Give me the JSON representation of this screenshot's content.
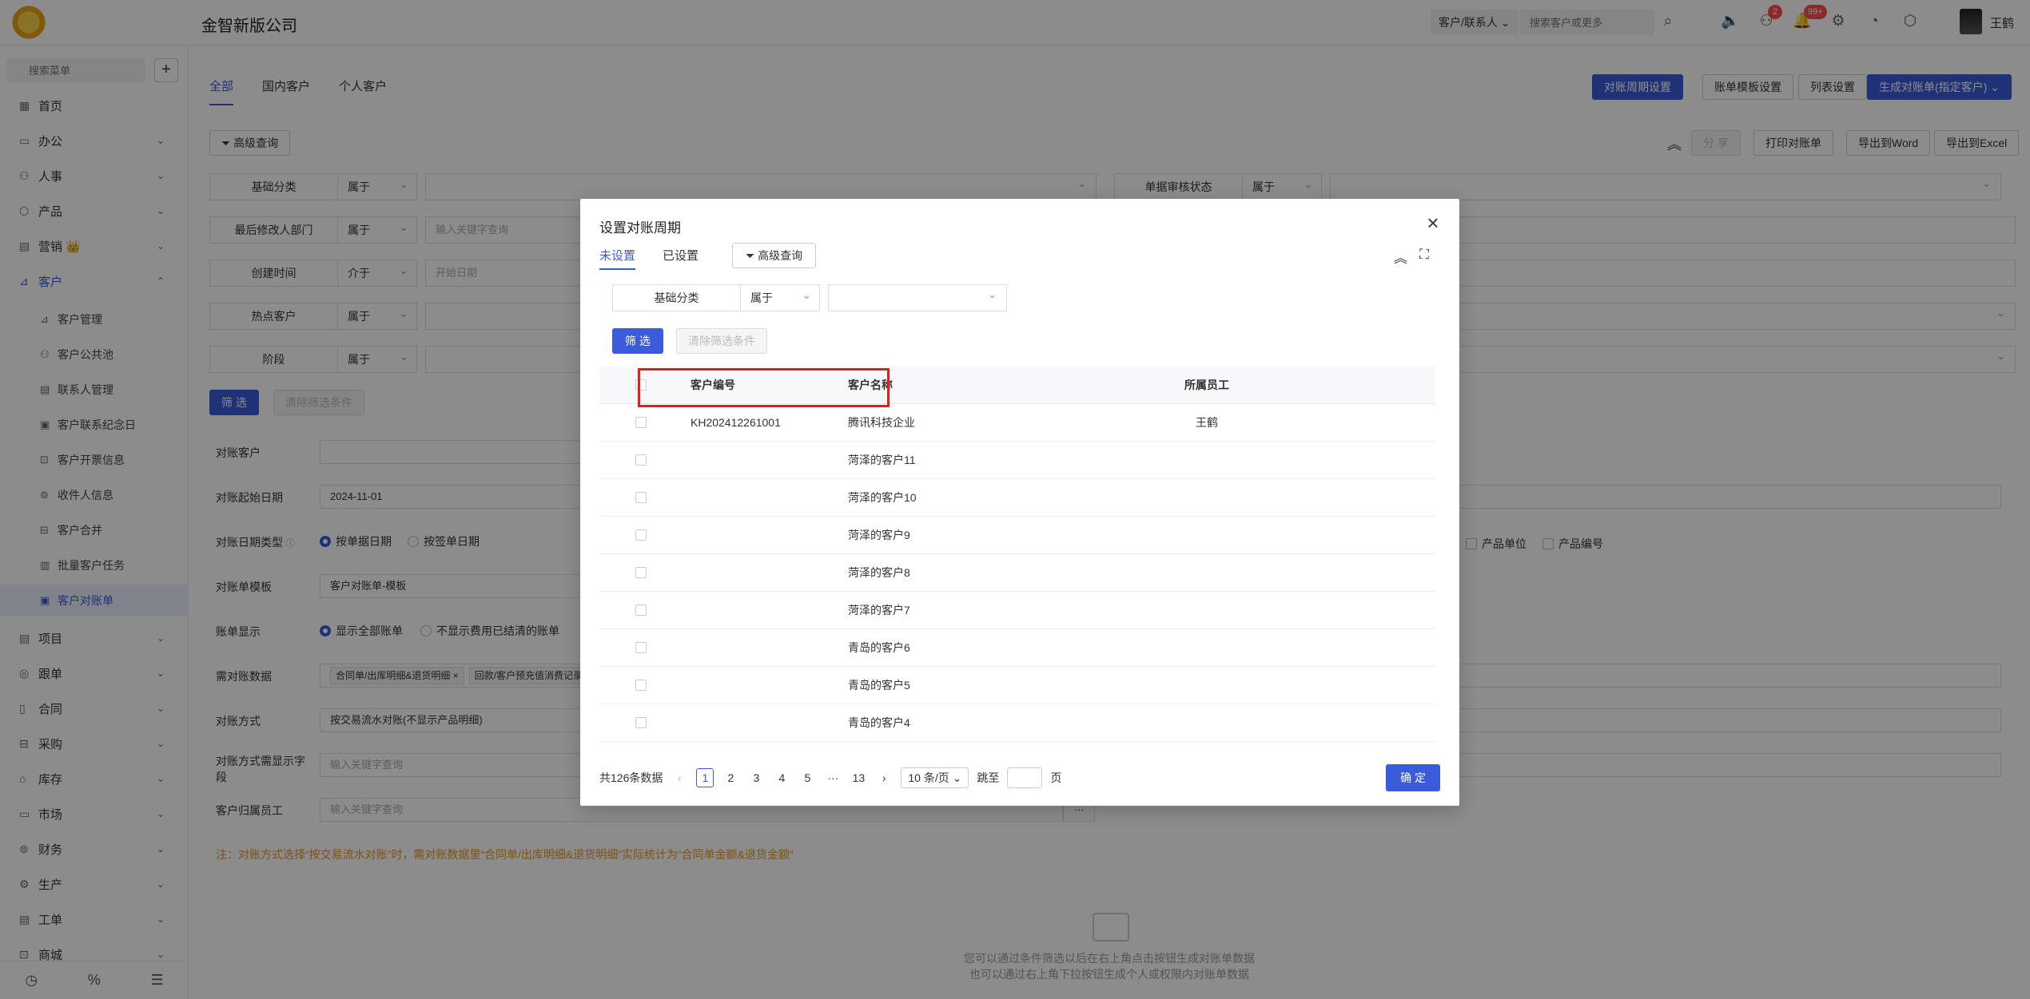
{
  "header": {
    "app_title": "金智新版公司",
    "search_type": "客户/联系人",
    "search_placeholder": "搜索客户或更多",
    "badges": {
      "notice": "2",
      "bell": "99+"
    },
    "user_name": "王鹤"
  },
  "sidebar": {
    "search_placeholder": "搜索菜单",
    "items": [
      {
        "label": "首页",
        "icon": "▦"
      },
      {
        "label": "办公",
        "icon": "▭"
      },
      {
        "label": "人事",
        "icon": "⚇"
      },
      {
        "label": "产品",
        "icon": "⬡"
      },
      {
        "label": "营销 👑",
        "icon": "▤"
      },
      {
        "label": "客户",
        "icon": "⊿"
      }
    ],
    "sub_items": [
      {
        "label": "客户管理",
        "icon": "⊿"
      },
      {
        "label": "客户公共池",
        "icon": "⚇"
      },
      {
        "label": "联系人管理",
        "icon": "▤"
      },
      {
        "label": "客户联系纪念日",
        "icon": "▣"
      },
      {
        "label": "客户开票信息",
        "icon": "⊡"
      },
      {
        "label": "收件人信息",
        "icon": "⊚"
      },
      {
        "label": "客户合并",
        "icon": "⊟"
      },
      {
        "label": "批量客户任务",
        "icon": "▥"
      },
      {
        "label": "客户对账单",
        "icon": "▣"
      }
    ],
    "bottom_items": [
      {
        "label": "项目",
        "icon": "▤"
      },
      {
        "label": "跟单",
        "icon": "◎"
      },
      {
        "label": "合同",
        "icon": "▯"
      },
      {
        "label": "采购",
        "icon": "⊟"
      },
      {
        "label": "库存",
        "icon": "⌂"
      },
      {
        "label": "市场",
        "icon": "▭"
      },
      {
        "label": "财务",
        "icon": "⊚"
      },
      {
        "label": "生产",
        "icon": "⚙"
      },
      {
        "label": "工单",
        "icon": "▤"
      },
      {
        "label": "商城",
        "icon": "⊡"
      }
    ]
  },
  "main": {
    "tabs": [
      "全部",
      "国内客户",
      "个人客户"
    ],
    "actions": {
      "cycle": "对账周期设置",
      "template": "账单模板设置",
      "columns": "列表设置",
      "generate": "生成对账单(指定客户)"
    },
    "advanced_query": "高级查询",
    "toolbar": {
      "share": "分 享",
      "print": "打印对账单",
      "word": "导出到Word",
      "excel": "导出到Excel"
    },
    "filters": [
      {
        "label": "基础分类",
        "op": "属于",
        "value": ""
      },
      {
        "label": "最后修改人部门",
        "op": "属于",
        "value": "输入关键字查询"
      },
      {
        "label": "创建时间",
        "op": "介于",
        "value": "开始日期"
      },
      {
        "label": "热点客户",
        "op": "属于",
        "value": ""
      },
      {
        "label": "阶段",
        "op": "属于",
        "value": ""
      }
    ],
    "right_filter": {
      "label": "单据审核状态",
      "op": "属于"
    },
    "filter_btn": "筛 选",
    "clear_btn": "清除筛选条件",
    "form": {
      "customer_label": "对账客户",
      "start_date_label": "对账起始日期",
      "start_date": "2024-11-01",
      "date_type_label": "对账日期类型",
      "date_type_opt1": "按单据日期",
      "date_type_opt2": "按签单日期",
      "template_label": "对账单模板",
      "template_value": "客户对账单-模板",
      "display_label": "账单显示",
      "display_opt1": "显示全部账单",
      "display_opt2": "不显示费用已结清的账单",
      "data_label": "需对账数据",
      "data_tag1": "合同单/出库明细&退货明细 ×",
      "data_tag2": "回款/客户预充值消费记录",
      "method_label": "对账方式",
      "method_value": "按交易流水对账(不显示产品明细)",
      "field_label": "对账方式需显示字段",
      "field_placeholder": "输入关键字查询",
      "owner_label": "客户归属员工",
      "owner_placeholder": "输入关键字查询",
      "chk_unit": "产品单位",
      "chk_code": "产品编号"
    },
    "note": "注：对账方式选择“按交易流水对账”时，需对账数据里“合同单/出库明细&退货明细”实际统计为“合同单金额&退货金额”",
    "empty_text_1": "您可以通过条件筛选以后在右上角点击按钮生成对账单数据",
    "empty_text_2": "也可以通过右上角下拉按钮生成个人或权限内对账单数据"
  },
  "modal": {
    "title": "设置对账周期",
    "tabs": [
      "未设置",
      "已设置"
    ],
    "advanced_query": "高级查询",
    "filter": {
      "label": "基础分类",
      "op": "属于",
      "value": ""
    },
    "filter_btn": "筛 选",
    "clear_btn": "清除筛选条件",
    "columns": {
      "code": "客户编号",
      "name": "客户名称",
      "employee": "所属员工"
    },
    "rows": [
      {
        "code": "KH202412261001",
        "name": "腾讯科技企业",
        "employee": "王鹤"
      },
      {
        "code": "",
        "name": "菏泽的客户11",
        "employee": ""
      },
      {
        "code": "",
        "name": "菏泽的客户10",
        "employee": ""
      },
      {
        "code": "",
        "name": "菏泽的客户9",
        "employee": ""
      },
      {
        "code": "",
        "name": "菏泽的客户8",
        "employee": ""
      },
      {
        "code": "",
        "name": "菏泽的客户7",
        "employee": ""
      },
      {
        "code": "",
        "name": "青岛的客户6",
        "employee": ""
      },
      {
        "code": "",
        "name": "青岛的客户5",
        "employee": ""
      },
      {
        "code": "",
        "name": "青岛的客户4",
        "employee": ""
      }
    ],
    "pager": {
      "total": "共126条数据",
      "pages": [
        "1",
        "2",
        "3",
        "4",
        "5",
        "···",
        "13"
      ],
      "page_size": "10 条/页",
      "jump_label": "跳至",
      "page_unit": "页"
    },
    "ok": "确 定"
  },
  "colors": {
    "primary": "#3a5bdb",
    "highlight": "#e02020",
    "note": "#e8941a"
  }
}
